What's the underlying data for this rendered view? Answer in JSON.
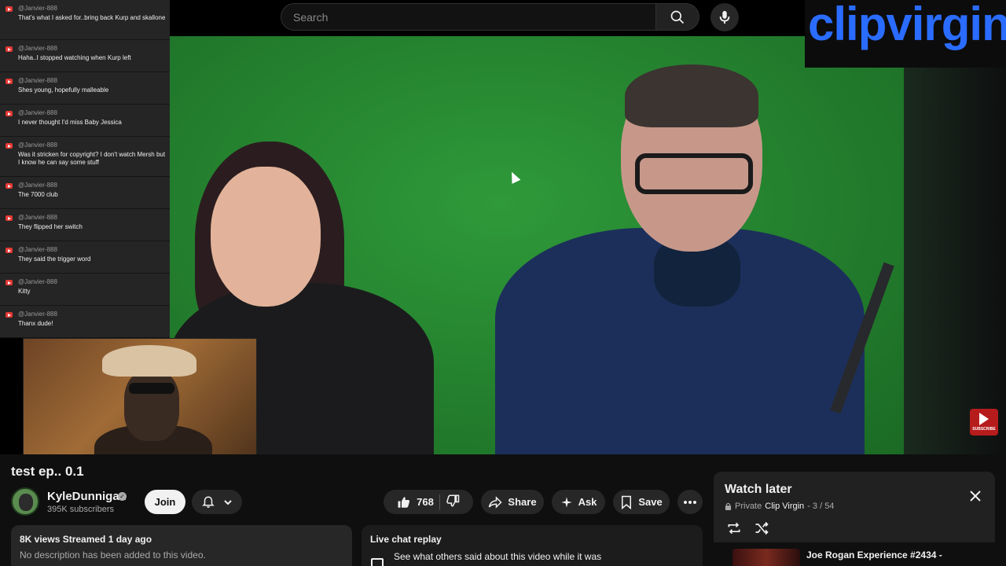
{
  "search": {
    "placeholder": "Search"
  },
  "logo": {
    "text": "clipvirgin"
  },
  "subscribe_badge": {
    "label": "SUBSCRIBE"
  },
  "chat": [
    {
      "user": "@Janvier-888",
      "text": "That's what I asked for..bring back Kurp and skallone"
    },
    {
      "user": "@Janvier-888",
      "text": "Haha..I stopped watching when Kurp left"
    },
    {
      "user": "@Janvier-888",
      "text": "Shes young, hopefully malleable"
    },
    {
      "user": "@Janvier-888",
      "text": "I never thought I'd miss Baby Jessica"
    },
    {
      "user": "@Janvier-888",
      "text": "Was it stricken for copyright? I don't watch Mersh but I know he can say some stuff"
    },
    {
      "user": "@Janvier-888",
      "text": "The 7000 club"
    },
    {
      "user": "@Janvier-888",
      "text": "They flipped her switch"
    },
    {
      "user": "@Janvier-888",
      "text": "They said the trigger word"
    },
    {
      "user": "@Janvier-888",
      "text": "Kitty"
    },
    {
      "user": "@Janvier-888",
      "text": "Thanx dude!"
    }
  ],
  "video": {
    "title": "test ep.. 0.1"
  },
  "channel": {
    "name": "KyleDunnigan",
    "subscribers": "395K subscribers",
    "join_label": "Join"
  },
  "actions": {
    "likes": "768",
    "share": "Share",
    "ask": "Ask",
    "save": "Save"
  },
  "description": {
    "meta": "8K views  Streamed 1 day ago",
    "text": "No description has been added to this video."
  },
  "chat_replay": {
    "title": "Live chat replay",
    "text": "See what others said about this video while it was"
  },
  "watch_later": {
    "title": "Watch later",
    "privacy": "Private",
    "channel": "Clip Virgin",
    "position": "- 3 / 54",
    "next_item_title": "Joe Rogan Experience #2434 -"
  }
}
